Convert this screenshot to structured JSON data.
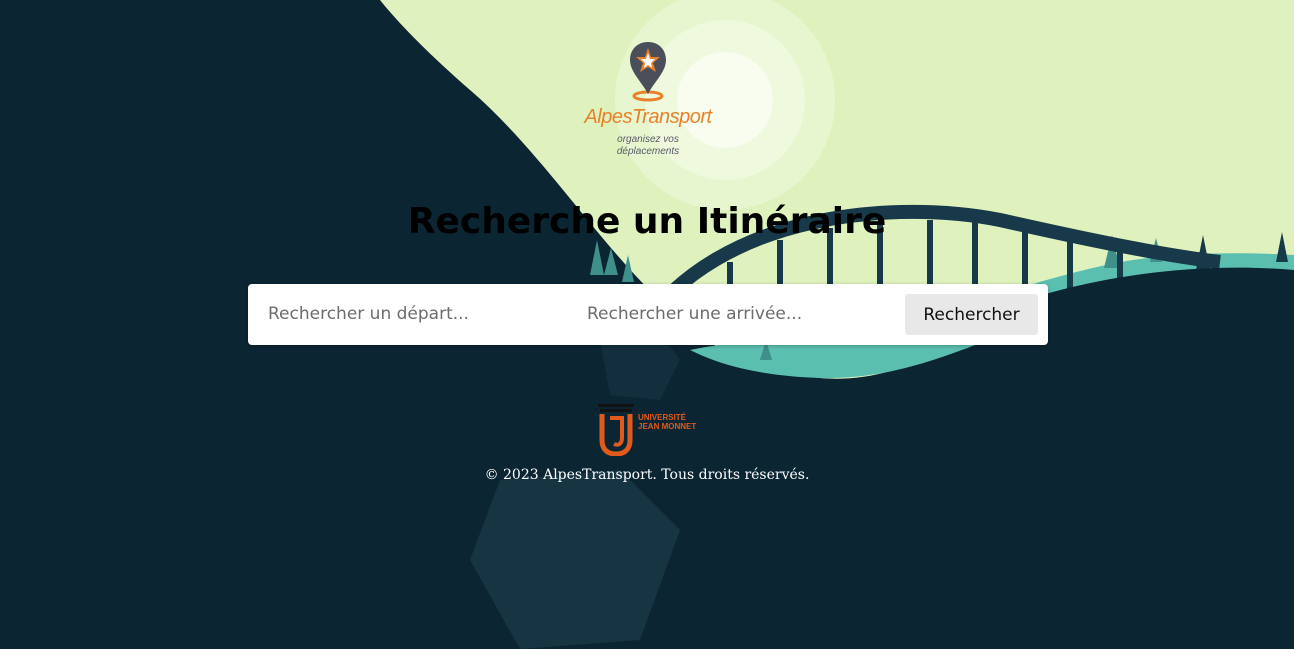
{
  "brand": {
    "name": "AlpesTransport",
    "tagline_line1": "organisez vos",
    "tagline_line2": "déplacements"
  },
  "page": {
    "title": "Recherche un Itinéraire"
  },
  "search": {
    "departure_placeholder": "Rechercher un départ...",
    "arrival_placeholder": "Rechercher une arrivée...",
    "submit_label": "Rechercher"
  },
  "partner": {
    "line1": "UNIVERSITÉ",
    "line2": "JEAN MONNET"
  },
  "footer": {
    "copyright": "© 2023 AlpesTransport. Tous droits réservés."
  },
  "colors": {
    "background_dark": "#0b2533",
    "sky": "#dff2bd",
    "hills": "#5bbfb0",
    "bridge": "#17394a",
    "brand_orange": "#e8822a",
    "university_orange": "#e05a1c"
  }
}
